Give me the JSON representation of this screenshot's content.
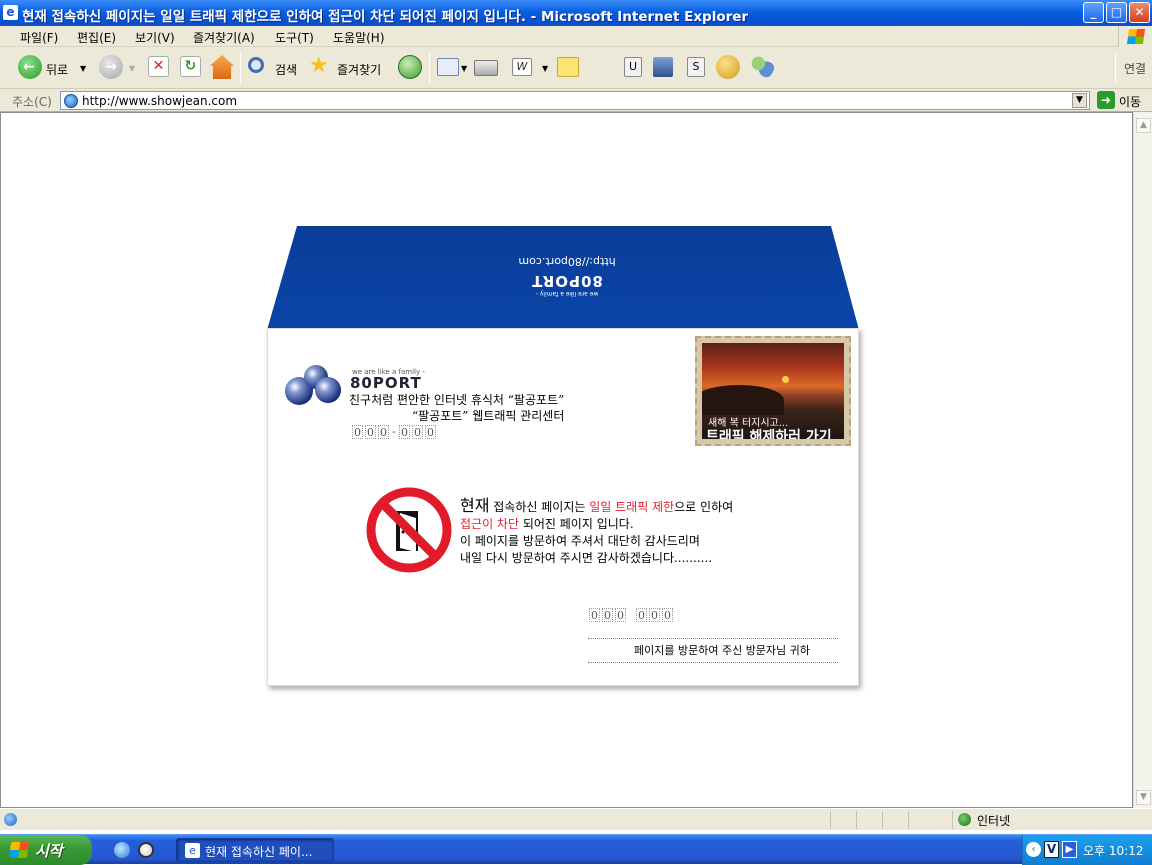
{
  "window": {
    "title": "현재 접속하신 페이지는 일일 트래픽 제한으로 인하여 접근이 차단 되어진 페이지 입니다. - Microsoft Internet Explorer",
    "minimize": "_",
    "maximize": "□",
    "close": "✕"
  },
  "menu": {
    "file": "파일(F)",
    "edit": "편집(E)",
    "view": "보기(V)",
    "favorites": "즐겨찾기(A)",
    "tools": "도구(T)",
    "help": "도움말(H)"
  },
  "toolbar": {
    "back": "뒤로",
    "search": "검색",
    "favorites": "즐겨찾기",
    "links": "연결"
  },
  "address": {
    "label": "주소(C)",
    "url": "http://www.showjean.com",
    "go": "이동"
  },
  "envelope": {
    "flap_url": "http://80port.com",
    "flap_logo": "80PORT",
    "flap_tagline": "we are like a family -",
    "logo_tagline": "we are like a family -",
    "logo_text": "80PORT",
    "sender_line1": "친구처럼 편안한 인터넷 휴식처 “팔공포트”",
    "sender_line2": "“팔공포트” 웹트래픽 관리센터",
    "sender_zip": [
      "0",
      "0",
      "0",
      "-",
      "0",
      "0",
      "0"
    ],
    "stamp_small": "새해 복 터지시고...",
    "stamp_big": "트래픽 해제하러 가기",
    "message": {
      "l1_big": "현재",
      "l1_a": " 접속하신 페이지는 ",
      "l1_red": "일일 트래픽 제한",
      "l1_b": "으로 인하여",
      "l2_red": "접근이 차단",
      "l2_b": " 되어진 페이지 입니다.",
      "l3": "이 페이지를 방문하여 주셔서 대단히 감사드리며",
      "l4": "내일 다시 방문하여 주시면 감사하겠습니다.........."
    },
    "recipient_zip": [
      "0",
      "0",
      "0",
      "",
      "0",
      "0",
      "0"
    ],
    "recipient": "페이지를 방문하여 주신 방문자님 귀하"
  },
  "status": {
    "zone": "인터넷"
  },
  "taskbar": {
    "start": "시작",
    "task": "현재 접속하신 페이...",
    "clock": "오후 10:12"
  },
  "colors": {
    "flap_blue": "#0a3d98",
    "red_text": "#e2222f",
    "xp_blue": "#0a5fe0"
  }
}
